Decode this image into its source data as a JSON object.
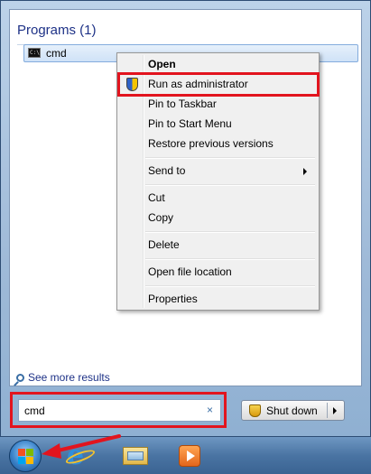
{
  "results": {
    "group_title": "Programs (1)",
    "item_label": "cmd",
    "cmd_icon_text": "C:\\",
    "see_more": "See more results"
  },
  "context_menu": {
    "items": [
      {
        "label": "Open"
      },
      {
        "label": "Run as administrator"
      },
      {
        "label": "Pin to Taskbar"
      },
      {
        "label": "Pin to Start Menu"
      },
      {
        "label": "Restore previous versions"
      },
      {
        "label": "Send to"
      },
      {
        "label": "Cut"
      },
      {
        "label": "Copy"
      },
      {
        "label": "Delete"
      },
      {
        "label": "Open file location"
      },
      {
        "label": "Properties"
      }
    ]
  },
  "search": {
    "value": "cmd",
    "clear": "×"
  },
  "shutdown": {
    "label": "Shut down"
  },
  "colors": {
    "highlight": "#e2141e",
    "link": "#1e3287"
  }
}
